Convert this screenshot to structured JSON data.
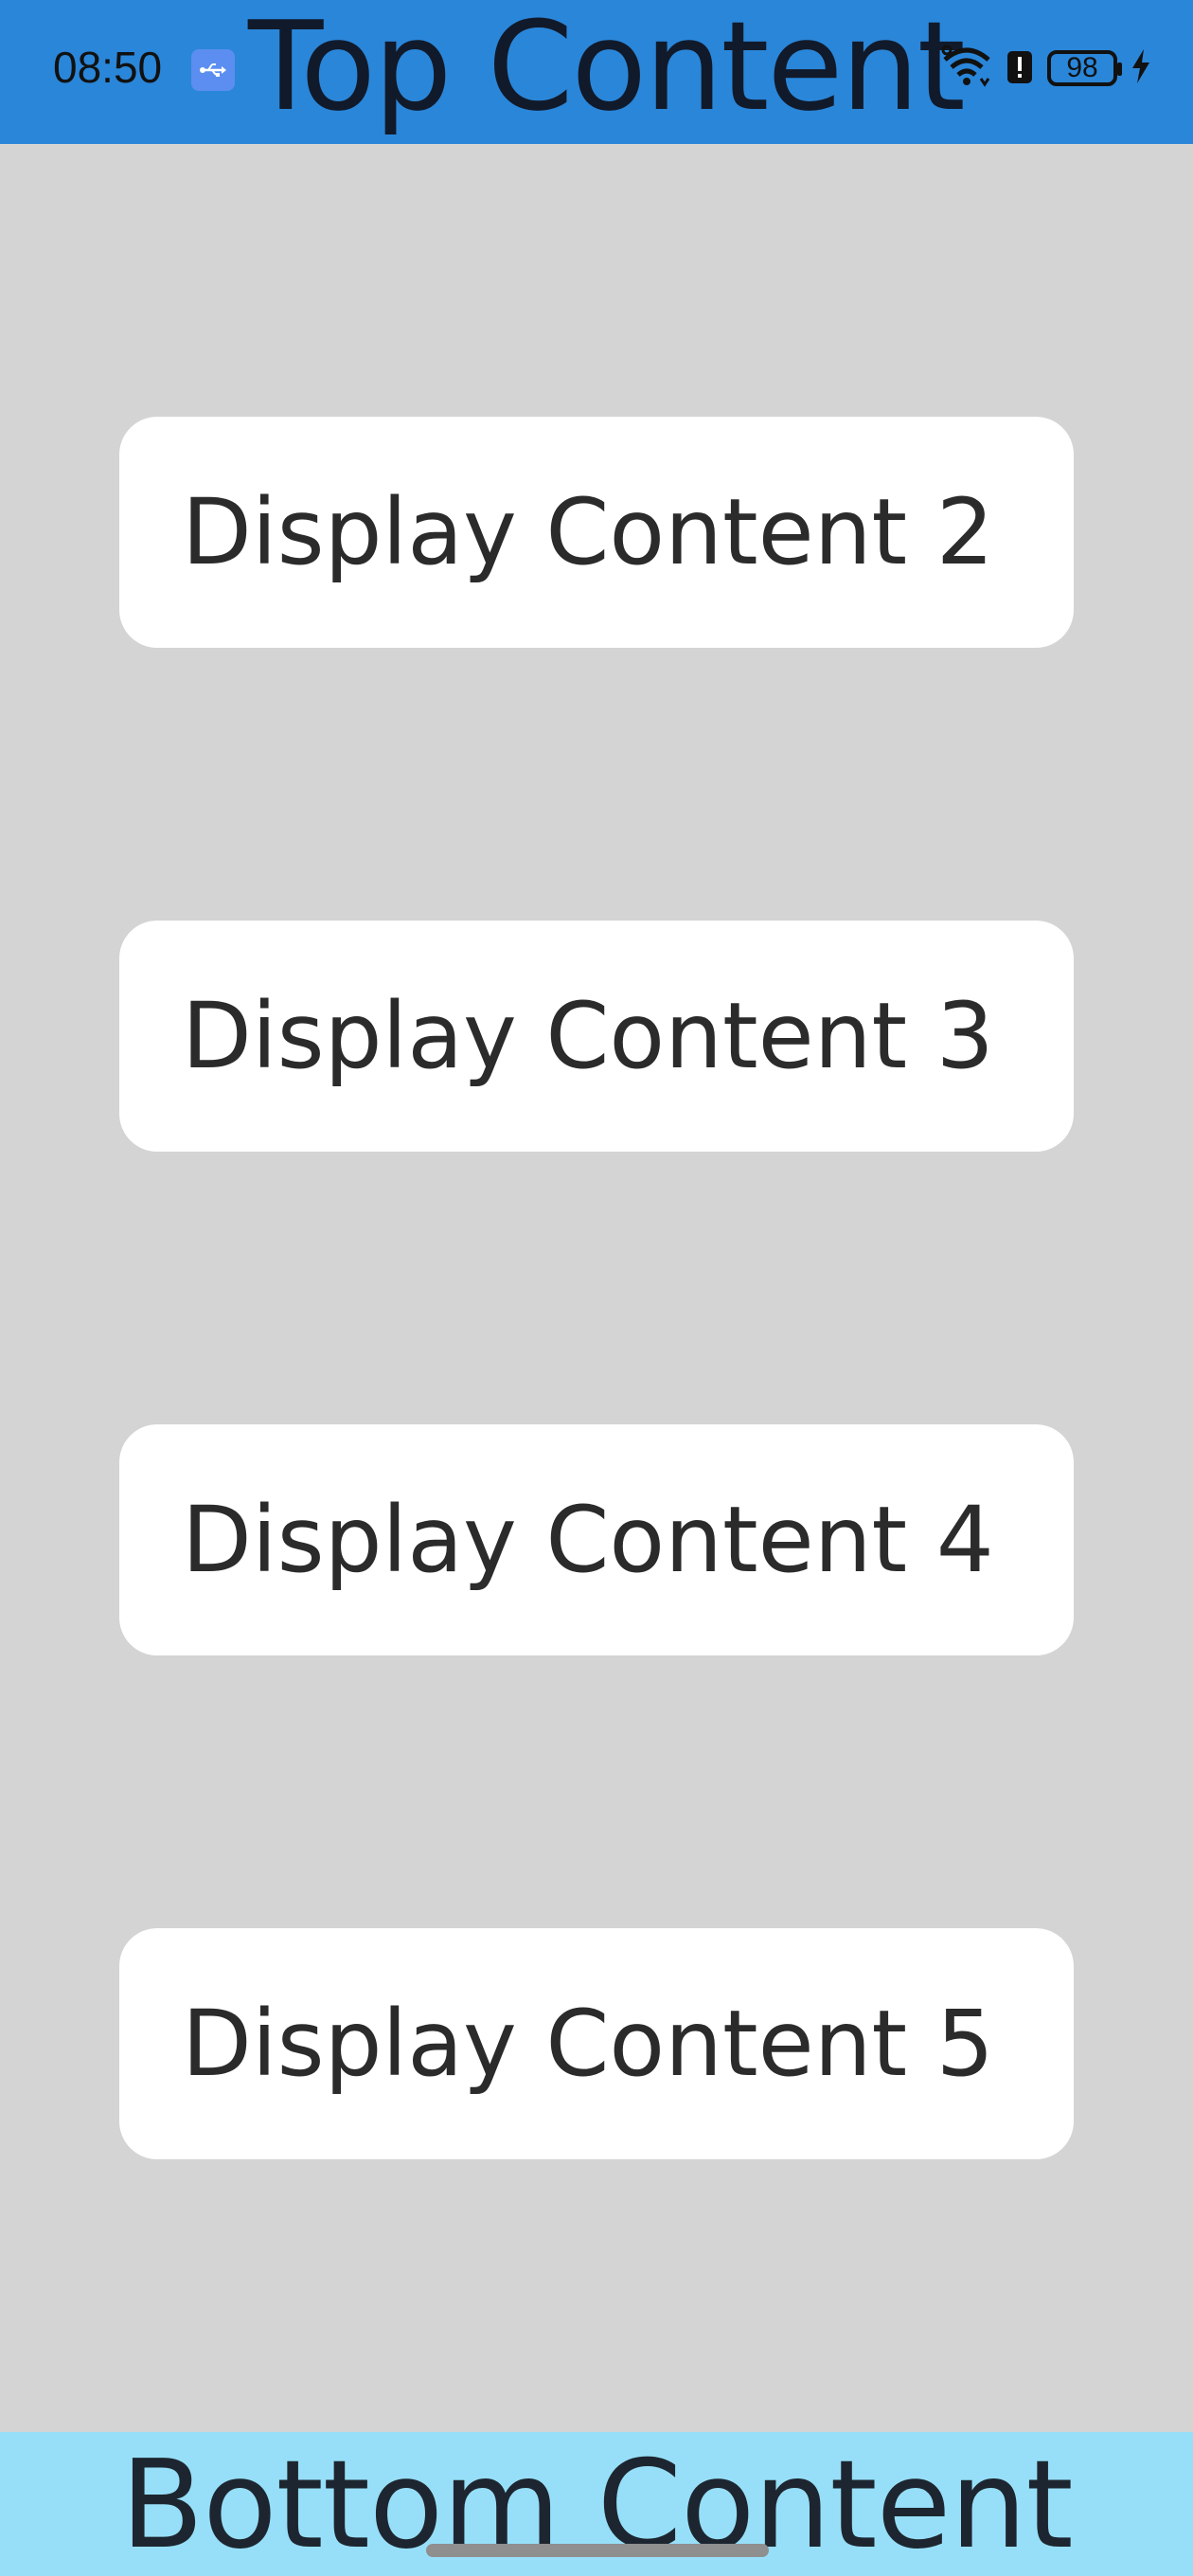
{
  "status_bar": {
    "time": "08:50",
    "battery_level": "98",
    "icons": [
      "usb-icon",
      "wifi-icon",
      "alert-icon",
      "battery-icon",
      "charging-icon"
    ]
  },
  "top": {
    "title": "Top Content",
    "color": "#2a86d9"
  },
  "cards": [
    {
      "label": "Display Content 2"
    },
    {
      "label": "Display Content 3"
    },
    {
      "label": "Display Content 4"
    },
    {
      "label": "Display Content 5"
    }
  ],
  "bottom": {
    "title": "Bottom Content",
    "color": "#97dff8"
  }
}
